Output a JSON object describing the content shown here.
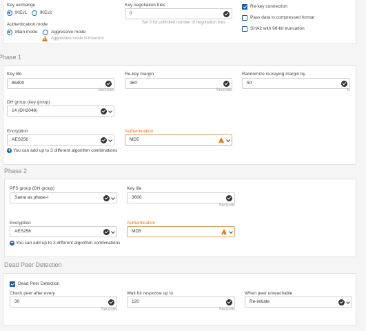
{
  "top": {
    "key_exchange": {
      "label": "Key exchange",
      "options": [
        "IKEv1",
        "IKEv2"
      ],
      "selected": "IKEv1"
    },
    "auth_mode": {
      "label": "Authentication mode",
      "options": [
        "Main mode",
        "Aggressive mode"
      ],
      "selected": "Main mode",
      "warning": "Aggressive mode is insecure"
    },
    "key_negotiation": {
      "label": "Key negotiation tries",
      "value": "0",
      "hint": "Set 0 for unlimited number of negotiation tries"
    },
    "checkboxes": [
      {
        "label": "Re-key connection",
        "checked": true
      },
      {
        "label": "Pass data in compressed format",
        "checked": false
      },
      {
        "label": "SHA2 with 96-bit truncation",
        "checked": false
      }
    ]
  },
  "phase1": {
    "title": "Phase 1",
    "key_life": {
      "label": "Key life",
      "value": "86400",
      "unit": "Seconds"
    },
    "rekey_margin": {
      "label": "Re-key margin",
      "value": "360",
      "unit": "Seconds"
    },
    "randomize": {
      "label": "Randomize re-keying margin by",
      "value": "50",
      "unit": "%"
    },
    "dh_group": {
      "label": "DH group (key group)",
      "value": "14 (DH2048)"
    },
    "encryption": {
      "label": "Encryption",
      "value": "AES256"
    },
    "authentication": {
      "label": "Authentication",
      "value": "MD5"
    },
    "add_note": "You can add up to 3 different algorithm combinations"
  },
  "phase2": {
    "title": "Phase 2",
    "pfs_group": {
      "label": "PFS group (DH group)",
      "value": "Same as phase-I"
    },
    "key_life": {
      "label": "Key life",
      "value": "3600",
      "unit": "Seconds"
    },
    "encryption": {
      "label": "Encryption",
      "value": "AES256"
    },
    "authentication": {
      "label": "Authentication",
      "value": "MD5"
    },
    "add_note": "You can add up to 3 different algorithm combinations"
  },
  "dpd": {
    "title": "Dead Peer Detection",
    "enabled": {
      "label": "Dead Peer Detection",
      "checked": true
    },
    "check_peer": {
      "label": "Check peer after every",
      "value": "30",
      "unit": "Seconds"
    },
    "wait_response": {
      "label": "Wait for response up to",
      "value": "120",
      "unit": "Seconds"
    },
    "unreachable": {
      "label": "When peer unreachable",
      "value": "Re-initiate"
    }
  }
}
